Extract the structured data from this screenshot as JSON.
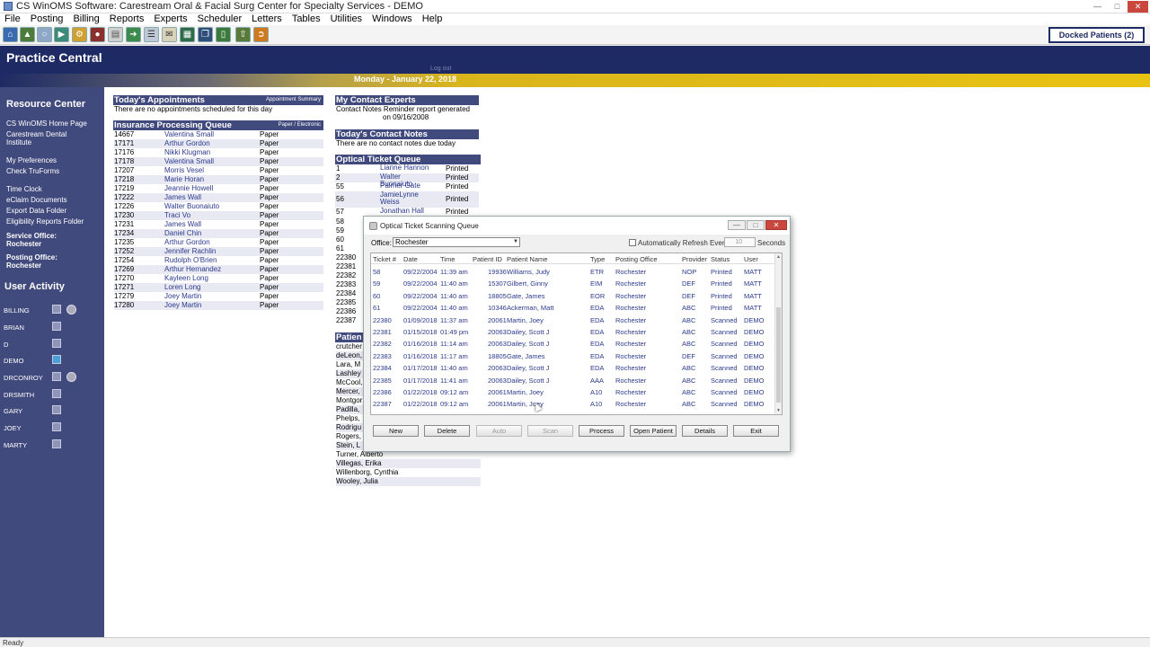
{
  "window": {
    "title": "CS WinOMS Software:  Carestream Oral & Facial Surg Center for Specialty Services - DEMO"
  },
  "menu": [
    "File",
    "Posting",
    "Billing",
    "Reports",
    "Experts",
    "Scheduler",
    "Letters",
    "Tables",
    "Utilities",
    "Windows",
    "Help"
  ],
  "toolbar": {
    "docked_label": "Docked Patients (2)"
  },
  "header": {
    "title": "Practice Central",
    "logout": "Log out",
    "date": "Monday - January 22, 2018"
  },
  "sidebar": {
    "resource_center": "Resource Center",
    "links": [
      "CS WinOMS Home Page",
      "Carestream Dental Institute",
      "My Preferences",
      "Check TruForms",
      "Time Clock",
      "eClaim Documents",
      "Export Data Folder",
      "Eligibility Reports Folder"
    ],
    "service_office_label": "Service Office:",
    "service_office_value": "Rochester",
    "posting_office_label": "Posting Office:",
    "posting_office_value": "Rochester",
    "user_activity": "User Activity",
    "users": [
      "BILLING",
      "BRIAN",
      "D",
      "DEMO",
      "DRCONROY",
      "DRSMITH",
      "GARY",
      "JOEY",
      "MARTY"
    ]
  },
  "appointments": {
    "title": "Today's Appointments",
    "link": "Appointment Summary",
    "message": "There are no appointments scheduled for this day"
  },
  "insurance_queue": {
    "title": "Insurance Processing Queue",
    "link": "Paper / Electronic",
    "rows": [
      [
        "14667",
        "Valentina Small",
        "Paper"
      ],
      [
        "17171",
        "Arthur Gordon",
        "Paper"
      ],
      [
        "17176",
        "Nikki Klugman",
        "Paper"
      ],
      [
        "17178",
        "Valentina Small",
        "Paper"
      ],
      [
        "17207",
        "Morris Vesel",
        "Paper"
      ],
      [
        "17218",
        "Marie Horan",
        "Paper"
      ],
      [
        "17219",
        "Jeannie Howell",
        "Paper"
      ],
      [
        "17222",
        "James Wall",
        "Paper"
      ],
      [
        "17226",
        "Walter Buonaiuto",
        "Paper"
      ],
      [
        "17230",
        "Traci Vo",
        "Paper"
      ],
      [
        "17231",
        "James Wall",
        "Paper"
      ],
      [
        "17234",
        "Daniel Chin",
        "Paper"
      ],
      [
        "17235",
        "Arthur Gordon",
        "Paper"
      ],
      [
        "17252",
        "Jennifer Rachlin",
        "Paper"
      ],
      [
        "17254",
        "Rudolph O'Brien",
        "Paper"
      ],
      [
        "17269",
        "Arthur Hernandez",
        "Paper"
      ],
      [
        "17270",
        "Kayleen Long",
        "Paper"
      ],
      [
        "17271",
        "Loren Long",
        "Paper"
      ],
      [
        "17279",
        "Joey Martin",
        "Paper"
      ],
      [
        "17280",
        "Joey Martin",
        "Paper"
      ]
    ]
  },
  "contact_experts": {
    "title": "My Contact Experts",
    "line1": "Contact Notes Reminder report generated",
    "line2": "on 09/16/2008"
  },
  "contact_notes": {
    "title": "Today's Contact Notes",
    "message": "There are no contact notes due today"
  },
  "optical_queue": {
    "title": "Optical Ticket Queue",
    "rows": [
      [
        "1",
        "Lianne Hannon",
        "Printed"
      ],
      [
        "2",
        "Walter Buonaiuto",
        "Printed"
      ],
      [
        "55",
        "Palmer Gate",
        "Printed"
      ],
      [
        "56",
        "JamieLynne Weiss",
        "Printed"
      ],
      [
        "57",
        "Jonathan Hall",
        "Printed"
      ]
    ],
    "hidden_ids": [
      "58",
      "59",
      "60",
      "61",
      "22380",
      "22381",
      "22382",
      "22383",
      "22384",
      "22385",
      "22386",
      "22387"
    ]
  },
  "patients": {
    "title": "Patien",
    "partial": [
      "crutcher",
      "deLeon,",
      "Lara, M",
      "Lashley",
      "McCool,",
      "Mercer,",
      "Montgor"
    ],
    "names": [
      "Padilla,",
      "Phelps,",
      "Rodrigu",
      "Rogers,",
      "Stein, L",
      "Turner, Alberto",
      "Villegas, Erika",
      "Willenborg, Cynthia",
      "Wooley, Julia"
    ]
  },
  "dialog": {
    "title": "Optical Ticket Scanning Queue",
    "office_label": "Office:",
    "office_value": "Rochester",
    "auto_refresh_label": "Automatically Refresh Every",
    "refresh_value": "10",
    "seconds_label": "Seconds",
    "columns": [
      "Ticket #",
      "Date",
      "Time",
      "Patient ID",
      "Patient Name",
      "Type",
      "Posting Office",
      "Provider",
      "Status",
      "User"
    ],
    "rows": [
      [
        "58",
        "09/22/2004",
        "11:39 am",
        "19936",
        "Williams, Judy",
        "ETR",
        "Rochester",
        "NOP",
        "Printed",
        "MATT"
      ],
      [
        "59",
        "09/22/2004",
        "11:40 am",
        "15307",
        "Gilbert, Ginny",
        "EIM",
        "Rochester",
        "DEF",
        "Printed",
        "MATT"
      ],
      [
        "60",
        "09/22/2004",
        "11:40 am",
        "18805",
        "Gate, James",
        "EOR",
        "Rochester",
        "DEF",
        "Printed",
        "MATT"
      ],
      [
        "61",
        "09/22/2004",
        "11:40 am",
        "10346",
        "Ackerman, Matt",
        "EDA",
        "Rochester",
        "ABC",
        "Printed",
        "MATT"
      ],
      [
        "22380",
        "01/09/2018",
        "11:37 am",
        "20061",
        "Martin, Joey",
        "EDA",
        "Rochester",
        "ABC",
        "Scanned",
        "DEMO"
      ],
      [
        "22381",
        "01/15/2018",
        "01:49 pm",
        "20063",
        "Dailey, Scott J",
        "EDA",
        "Rochester",
        "ABC",
        "Scanned",
        "DEMO"
      ],
      [
        "22382",
        "01/16/2018",
        "11:14 am",
        "20063",
        "Dailey, Scott J",
        "EDA",
        "Rochester",
        "ABC",
        "Scanned",
        "DEMO"
      ],
      [
        "22383",
        "01/16/2018",
        "11:17 am",
        "18805",
        "Gate, James",
        "EDA",
        "Rochester",
        "DEF",
        "Scanned",
        "DEMO"
      ],
      [
        "22384",
        "01/17/2018",
        "11:40 am",
        "20063",
        "Dailey, Scott J",
        "EDA",
        "Rochester",
        "ABC",
        "Scanned",
        "DEMO"
      ],
      [
        "22385",
        "01/17/2018",
        "11:41 am",
        "20063",
        "Dailey, Scott J",
        "AAA",
        "Rochester",
        "ABC",
        "Scanned",
        "DEMO"
      ],
      [
        "22386",
        "01/22/2018",
        "09:12 am",
        "20061",
        "Martin, Joey",
        "A10",
        "Rochester",
        "ABC",
        "Scanned",
        "DEMO"
      ],
      [
        "22387",
        "01/22/2018",
        "09:12 am",
        "20061",
        "Martin, Joey",
        "A10",
        "Rochester",
        "ABC",
        "Scanned",
        "DEMO"
      ]
    ],
    "buttons": [
      "New",
      "Delete",
      "Auto",
      "Scan",
      "Process",
      "Open Patient",
      "Details",
      "Exit"
    ]
  },
  "status": {
    "text": "Ready"
  }
}
